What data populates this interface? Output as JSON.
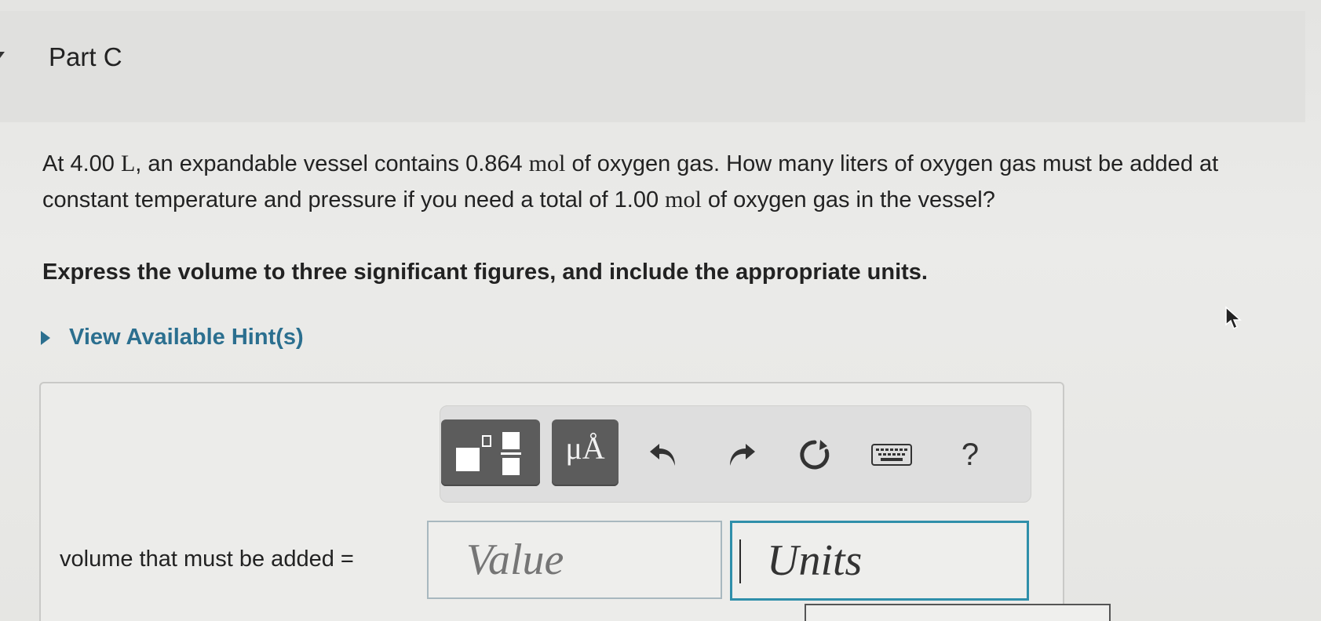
{
  "part": {
    "title": "Part C"
  },
  "question": {
    "segments": [
      {
        "text": "At 4.00 ",
        "math": false
      },
      {
        "text": "L",
        "math": true
      },
      {
        "text": ", an expandable vessel contains 0.864 ",
        "math": false
      },
      {
        "text": "mol",
        "math": true
      },
      {
        "text": " of oxygen gas. How many liters of oxygen gas must be added at constant temperature and pressure if you need a total of 1.00 ",
        "math": false
      },
      {
        "text": "mol",
        "math": true
      },
      {
        "text": " of oxygen gas in the vessel?",
        "math": false
      }
    ]
  },
  "instruction": "Express the volume to three significant figures, and include the appropriate units.",
  "hints": {
    "label": "View Available Hint(s)"
  },
  "toolbar": {
    "units_glyph": "μÅ",
    "help_glyph": "?",
    "icons": [
      "templates-icon",
      "units-icon",
      "undo-icon",
      "redo-icon",
      "reset-icon",
      "keyboard-icon",
      "help-icon"
    ]
  },
  "answer": {
    "label": "volume that must be added =",
    "value_placeholder": "Value",
    "units_placeholder": "Units"
  },
  "colors": {
    "accent": "#2b6f8f",
    "focus_border": "#2f8faa",
    "button_dark": "#5c5c5c"
  }
}
